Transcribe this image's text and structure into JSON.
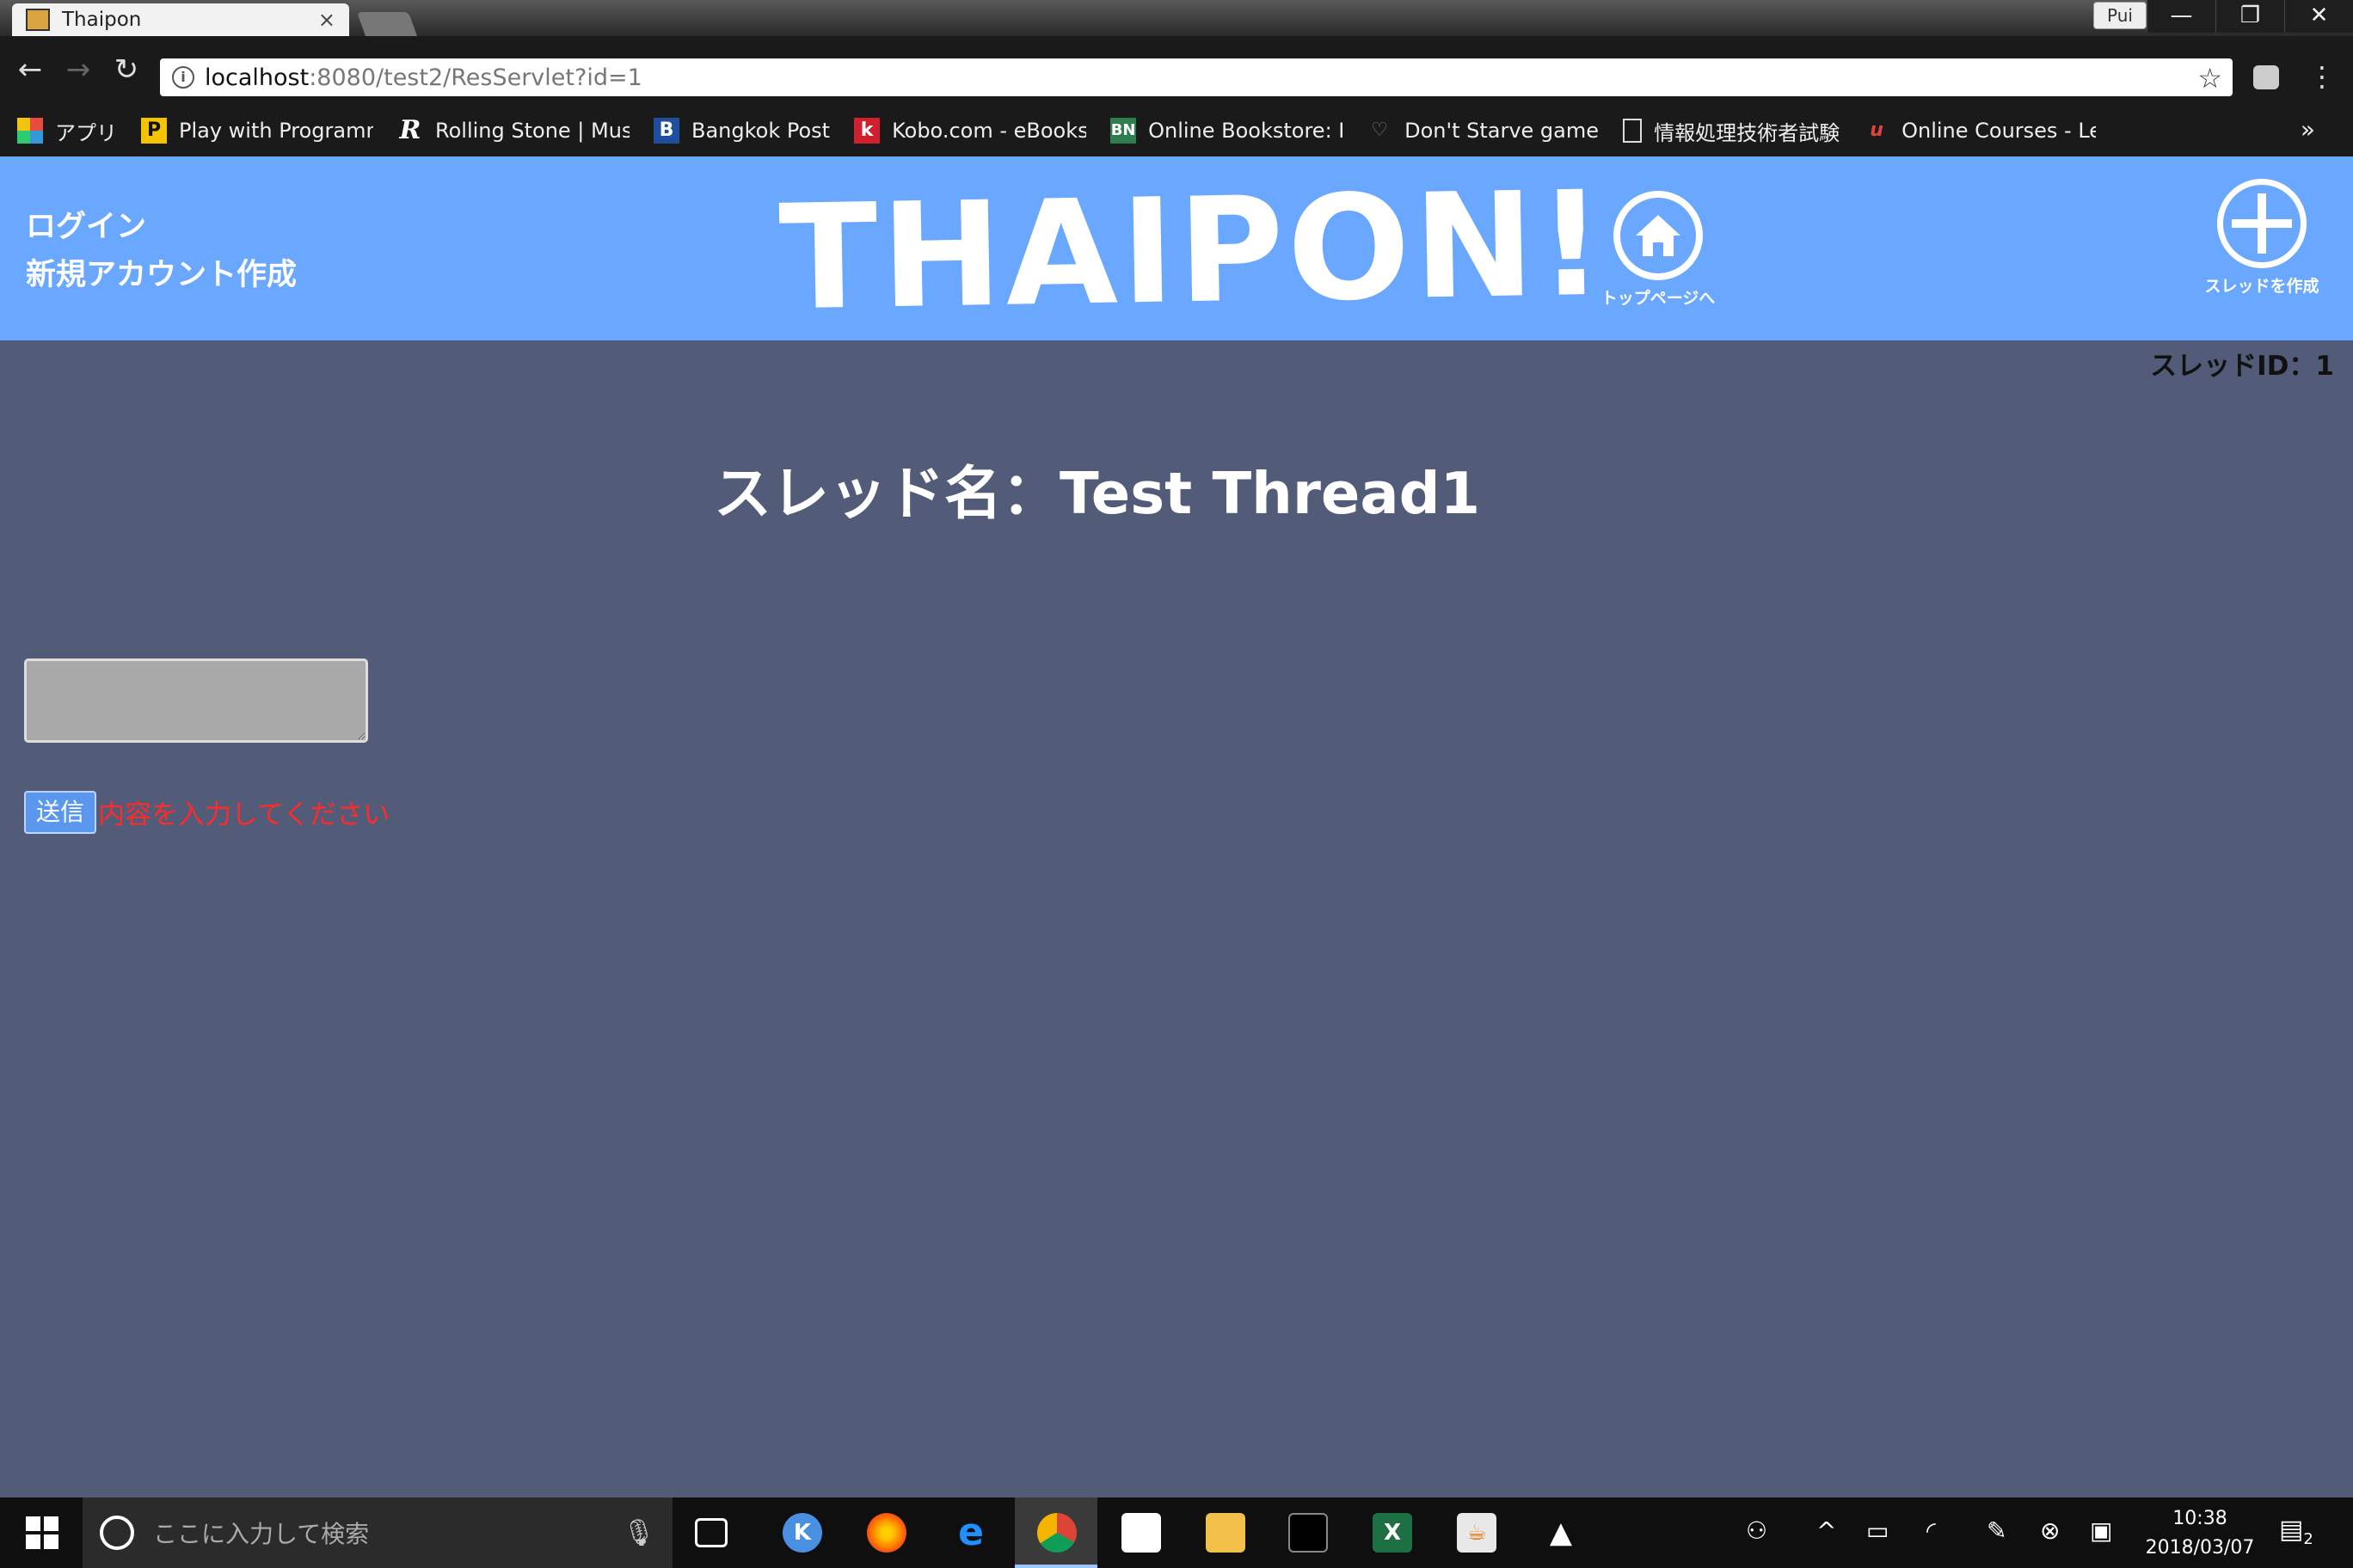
{
  "browser": {
    "tab_title": "Thaipon",
    "tab_close": "×",
    "profile": "Pui",
    "window_controls": [
      "—",
      "❐",
      "✕"
    ],
    "url_host": "localhost",
    "url_path": ":8080/test2/ResServlet?id=1",
    "bookmarks": [
      {
        "label": "アプリ",
        "icon": "apps-grid-icon",
        "color": "#e74c3c"
      },
      {
        "label": "Play with Programmi",
        "icon": "playground-icon",
        "color": "#f5c400"
      },
      {
        "label": "Rolling Stone | Music",
        "icon": "rolling-stone-icon",
        "color": "#1a1a1a"
      },
      {
        "label": "Bangkok Post",
        "icon": "bangkok-post-icon",
        "color": "#1f4e9c"
      },
      {
        "label": "Kobo.com - eBooks, ",
        "icon": "kobo-icon",
        "color": "#d01f2e"
      },
      {
        "label": "Online Bookstore: Bo",
        "icon": "barnes-noble-icon",
        "color": "#2e7d4f"
      },
      {
        "label": "Don't Starve game W",
        "icon": "heart-icon",
        "color": "#1a1a1a"
      },
      {
        "label": "情報処理技術者試験",
        "icon": "document-icon",
        "color": "#1a1a1a"
      },
      {
        "label": "Online Courses - Lear",
        "icon": "udemy-icon",
        "color": "#1a1a1a"
      }
    ],
    "bookmarks_more": "»"
  },
  "header": {
    "login_label": "ログイン",
    "signup_label": "新規アカウント作成",
    "logo_text": "THAIPON!",
    "home_label": "トップページへ",
    "create_thread_label": "スレッドを作成"
  },
  "main": {
    "thread_id_label": "スレッドID：1",
    "thread_title": "スレッド名：Test Thread1",
    "input_value": "",
    "submit_label": "送信",
    "error_message": "内容を入力してください"
  },
  "taskbar": {
    "search_placeholder": "ここに入力して検索",
    "time": "10:38",
    "date": "2018/03/07",
    "notification_count": "2"
  },
  "colors": {
    "header_bg": "#6aa8ff",
    "page_bg": "#525c78",
    "error": "#ff2a2a",
    "submit_bg": "#5a98f0"
  }
}
